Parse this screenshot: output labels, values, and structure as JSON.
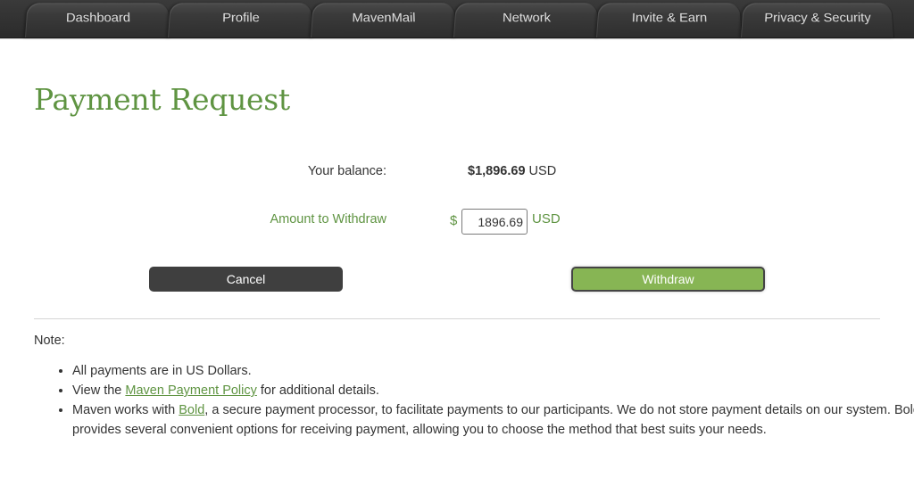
{
  "nav": {
    "tabs": [
      {
        "label": "Dashboard"
      },
      {
        "label": "Profile"
      },
      {
        "label": "MavenMail"
      },
      {
        "label": "Network"
      },
      {
        "label": "Invite & Earn"
      },
      {
        "label": "Privacy & Security"
      }
    ]
  },
  "page": {
    "title": "Payment Request"
  },
  "form": {
    "balance_label": "Your balance:",
    "balance_amount": "$1,896.69",
    "balance_currency": "USD",
    "amount_label": "Amount to Withdraw",
    "currency_symbol": "$",
    "amount_value": "1896.69",
    "amount_currency": "USD"
  },
  "buttons": {
    "cancel_label": "Cancel",
    "withdraw_label": "Withdraw"
  },
  "notes": {
    "label": "Note:",
    "item1": "All payments are in US Dollars.",
    "item2_prefix": "View the ",
    "item2_link": "Maven Payment Policy",
    "item2_suffix": " for additional details.",
    "item3_prefix": "Maven works with ",
    "item3_link": "Bold",
    "item3_suffix": ", a secure payment processor, to facilitate payments to our participants. We do not store payment details on our system. Bold provides several convenient options for receiving payment, allowing you to choose the method that best suits your needs."
  },
  "colors": {
    "brand_green": "#5f9442",
    "button_green": "#87b554",
    "button_dark": "#3f3f3f",
    "nav_bg": "#2e2e2e"
  }
}
